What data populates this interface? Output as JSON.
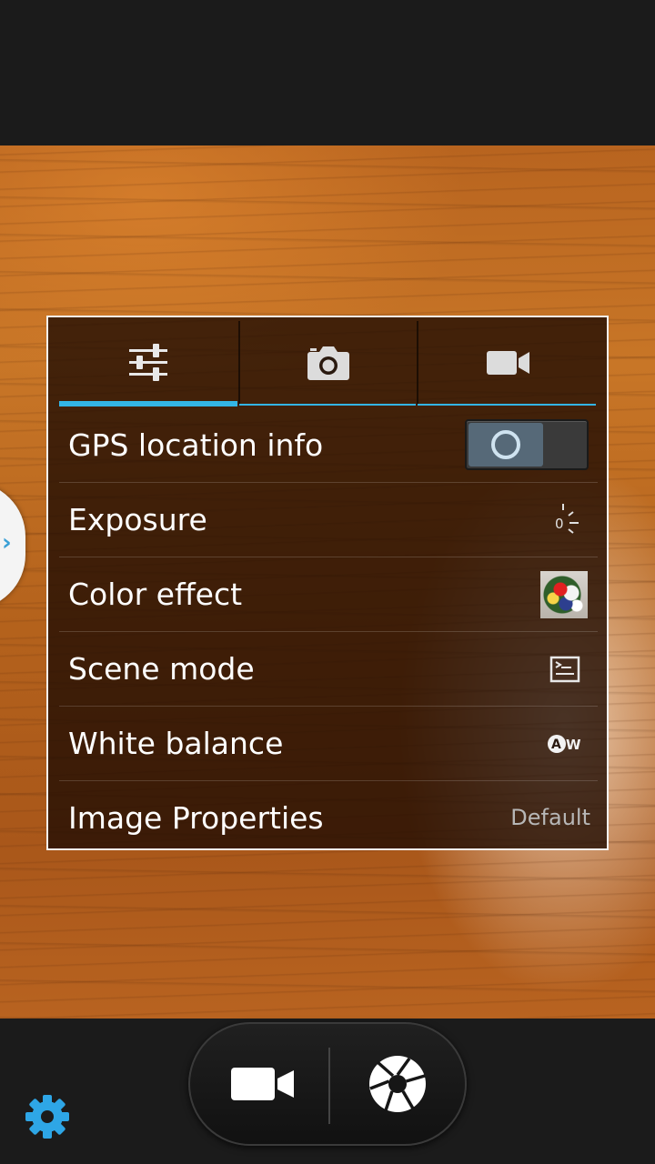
{
  "tabs": [
    {
      "icon": "sliders-icon",
      "active": true
    },
    {
      "icon": "camera-icon",
      "active": false
    },
    {
      "icon": "video-camera-icon",
      "active": false
    }
  ],
  "settings": {
    "gps": {
      "label": "GPS location info",
      "enabled": false
    },
    "exposure": {
      "label": "Exposure",
      "value": "0",
      "icon": "exposure-icon"
    },
    "color_effect": {
      "label": "Color effect",
      "icon": "flower-thumbnail"
    },
    "scene_mode": {
      "label": "Scene mode",
      "icon": "scene-auto-icon"
    },
    "white_balance": {
      "label": "White balance",
      "icon_text": "AW",
      "icon": "white-balance-auto-icon"
    },
    "image_properties": {
      "label": "Image Properties",
      "value": "Default"
    }
  },
  "controls": {
    "video_button_icon": "video-camera-icon",
    "shutter_button_icon": "shutter-icon",
    "settings_icon": "gear-icon"
  },
  "colors": {
    "accent": "#33b5e5",
    "gear": "#2ea6e6",
    "toggle_thumb": "#566978"
  }
}
